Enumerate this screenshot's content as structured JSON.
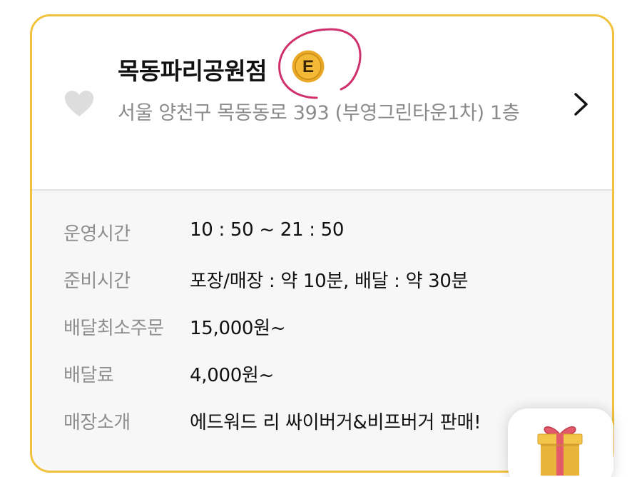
{
  "store": {
    "name": "목동파리공원점",
    "grade_badge": "E",
    "address": "서울 양천구 목동동로 393 (부영그린타운1차) 1층",
    "favorite": false
  },
  "info_rows": [
    {
      "label": "운영시간",
      "value": "10 : 50 ~ 21 : 50"
    },
    {
      "label": "준비시간",
      "value": "포장/매장 : 약 10분, 배달 : 약 30분"
    },
    {
      "label": "배달최소주문",
      "value": "15,000원~"
    },
    {
      "label": "배달료",
      "value": "4,000원~"
    },
    {
      "label": "매장소개",
      "value": "에드워드 리 싸이버거&비프버거 판매!"
    }
  ],
  "icons": {
    "favorite": "heart-icon",
    "detail": "chevron-right-icon",
    "gift": "gift-icon",
    "grade": "grade-badge-icon"
  },
  "colors": {
    "card_border": "#f2c23d",
    "badge_gold": "#e9a825",
    "highlight_pen": "#d0306c",
    "label_gray": "#8e8e8e",
    "heart_gray": "#dddddd"
  }
}
